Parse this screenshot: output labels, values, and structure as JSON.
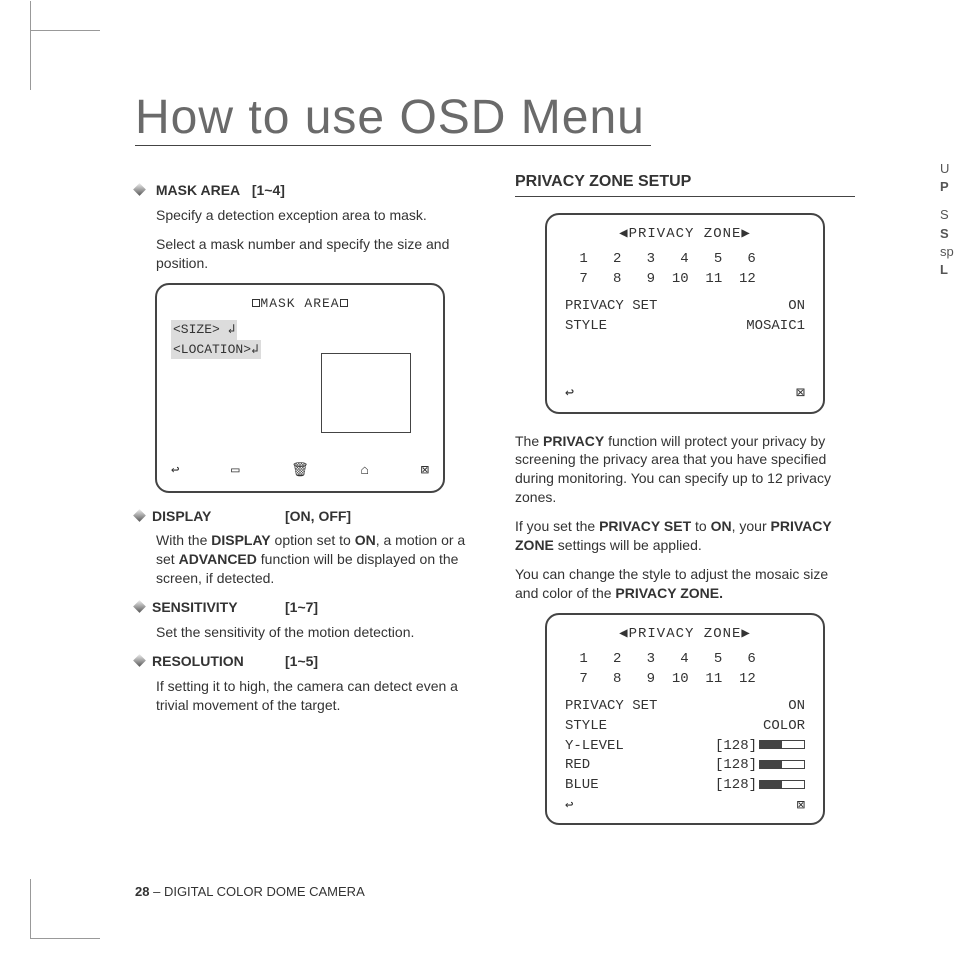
{
  "page_title": "How to use OSD Menu",
  "left": {
    "mask_area": {
      "heading": "MASK AREA",
      "range": "[1~4]",
      "p1": "Specify a detection exception area to mask.",
      "p2": "Select a mask number and specify the size and position."
    },
    "mask_box": {
      "title": "◙MASK AREA◙",
      "size": "<SIZE> ↲",
      "location": "<LOCATION>↲",
      "icons": {
        "back": "↩",
        "a": "▭",
        "b": "🗑",
        "c": "⌂",
        "close": "⊠"
      }
    },
    "display": {
      "heading": "DISPLAY",
      "range": "[ON, OFF]",
      "text_pre": "With the ",
      "bold1": "DISPLAY",
      "text_mid1": " option set to ",
      "bold2": "ON",
      "text_mid2": ", a motion or a set ",
      "bold3": "ADVANCED",
      "text_post": " function will be displayed on the screen, if detected."
    },
    "sensitivity": {
      "heading": "SENSITIVITY",
      "range": "[1~7]",
      "text": "Set the sensitivity of the motion detection."
    },
    "resolution": {
      "heading": "RESOLUTION",
      "range": "[1~5]",
      "text": "If setting it to high, the camera can detect even a trivial movement of the target."
    }
  },
  "right": {
    "heading": "PRIVACY ZONE SETUP",
    "osd1": {
      "title": "◀PRIVACY ZONE▶",
      "nums1": " 1   2   3   4   5   6",
      "nums2": " 7   8   9  10  11  12",
      "row1_l": "PRIVACY SET",
      "row1_r": "ON",
      "row2_l": "STYLE",
      "row2_r": "MOSAIC1",
      "back": "↩",
      "close": "⊠"
    },
    "p1_a": "The ",
    "p1_b": "PRIVACY",
    "p1_c": " function will protect your privacy by screening the privacy area that you have specified during monitoring. You can specify up to 12 privacy zones.",
    "p2_a": "If you set the ",
    "p2_b": "PRIVACY SET",
    "p2_c": " to ",
    "p2_d": "ON",
    "p2_e": ", your ",
    "p2_f": "PRIVACY ZONE",
    "p2_g": " settings will be applied.",
    "p3_a": "You can change the style to adjust the mosaic size and color of the ",
    "p3_b": "PRIVACY ZONE.",
    "osd2": {
      "title": "◀PRIVACY ZONE▶",
      "nums1": " 1   2   3   4   5   6",
      "nums2": " 7   8   9  10  11  12",
      "row1_l": "PRIVACY SET",
      "row1_r": "ON",
      "row2_l": "STYLE",
      "row2_r": "COLOR",
      "row3_l": " Y-LEVEL",
      "row3_r": "[128]",
      "row4_l": " RED",
      "row4_r": "[128]",
      "row5_l": " BLUE",
      "row5_r": "[128]",
      "back": "↩",
      "close": "⊠"
    }
  },
  "cutoff": {
    "l1": "U",
    "l2": "P",
    "l3": "S",
    "l4": "S",
    "l5": "sp",
    "l6": "L"
  },
  "footer": {
    "page": "28",
    "sep": " – ",
    "label": "DIGITAL COLOR DOME CAMERA"
  }
}
